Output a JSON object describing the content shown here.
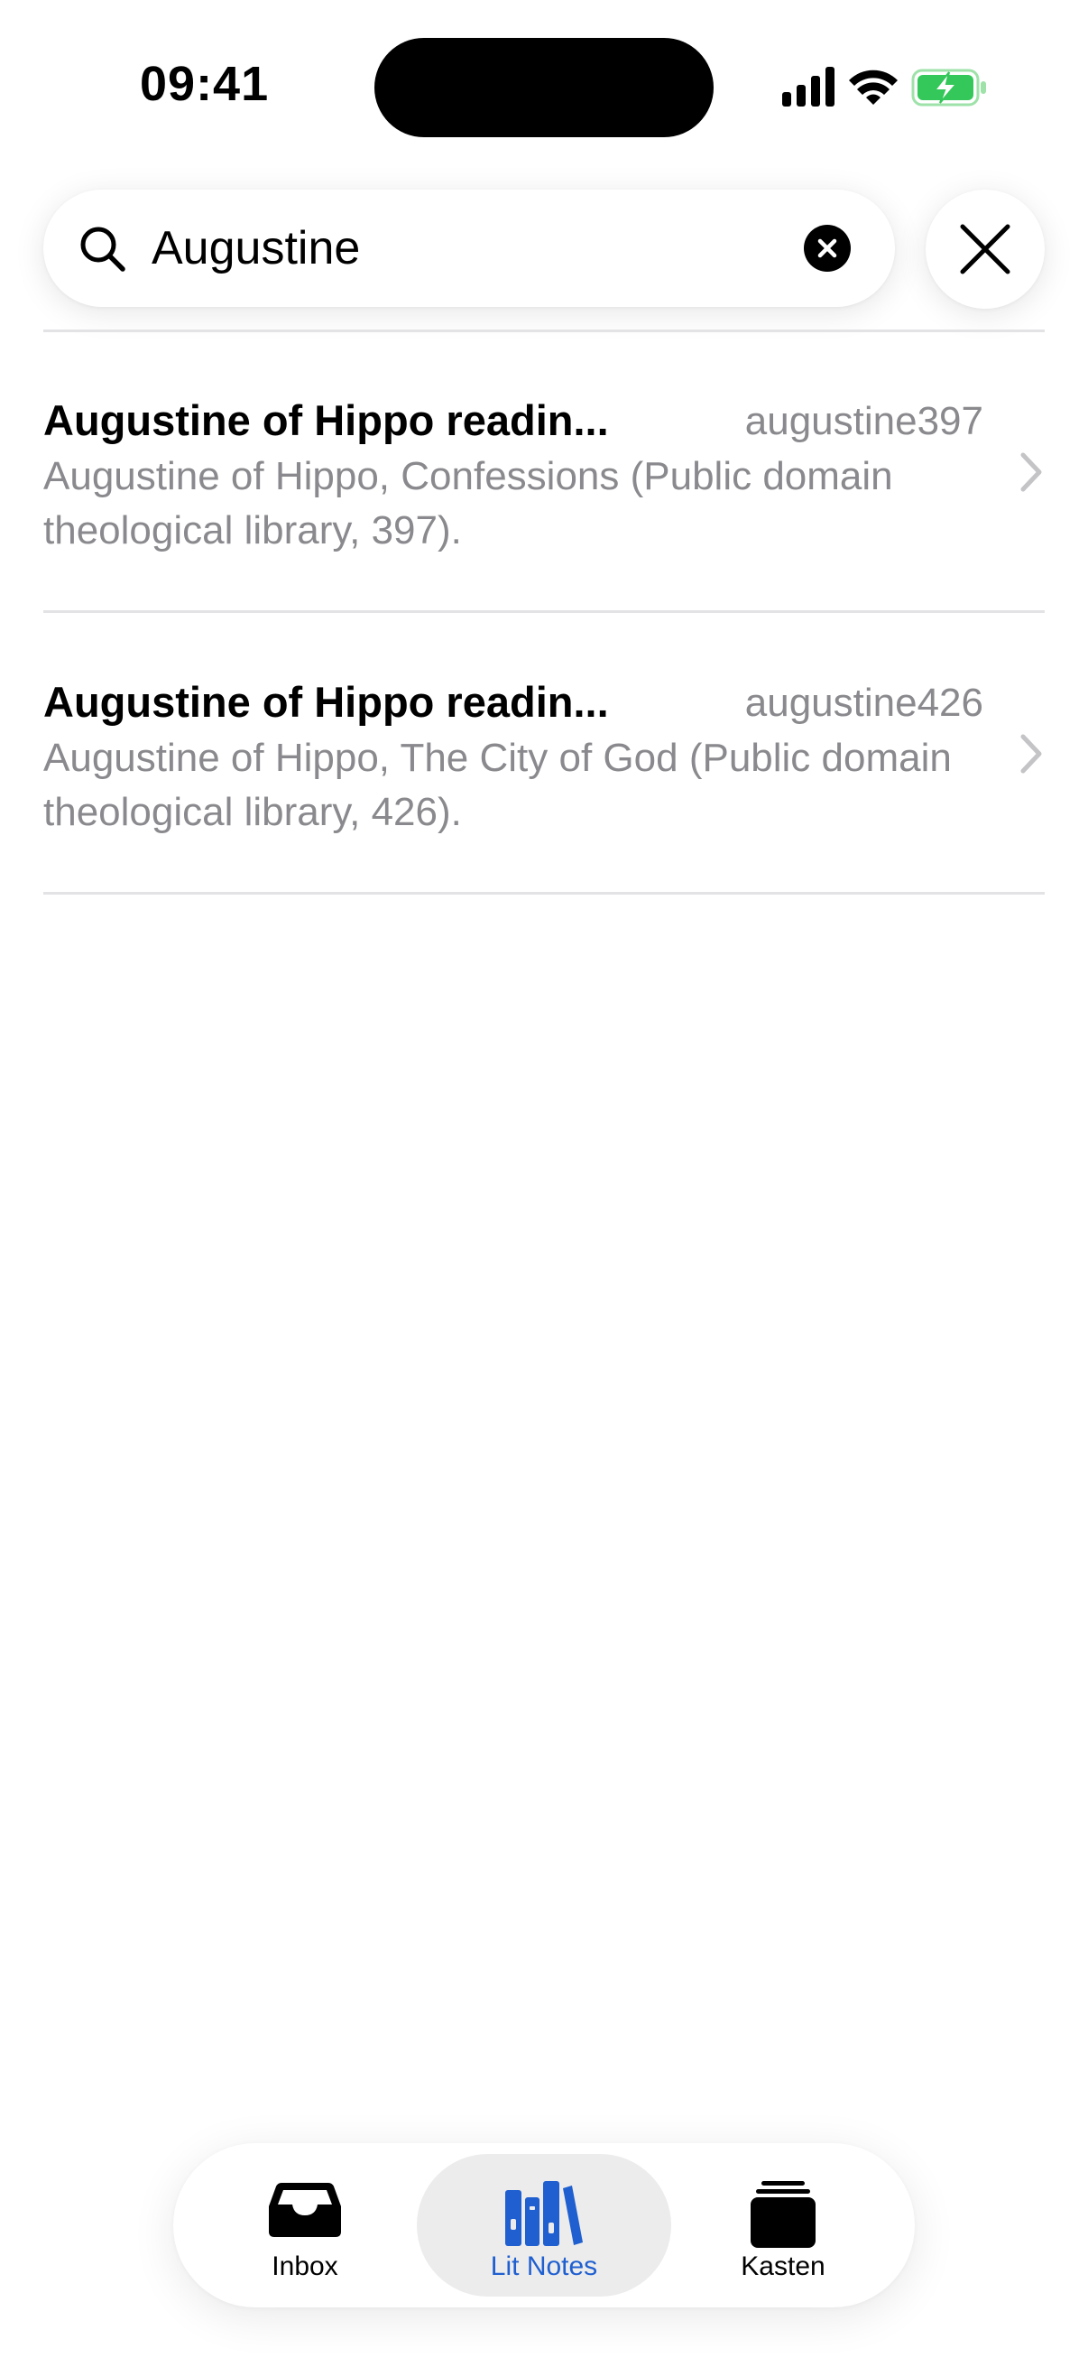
{
  "status_bar": {
    "time": "09:41"
  },
  "search": {
    "value": "Augustine",
    "placeholder": ""
  },
  "results": [
    {
      "title": "Augustine of Hippo readin...",
      "key": "augustine397",
      "description": "Augustine of Hippo, Confessions (Public domain theological library, 397)."
    },
    {
      "title": "Augustine of Hippo readin...",
      "key": "augustine426",
      "description": "Augustine of Hippo, The City of God (Public domain theological library, 426)."
    }
  ],
  "tab_bar": {
    "tabs": [
      {
        "label": "Inbox",
        "icon": "tray-icon",
        "active": false
      },
      {
        "label": "Lit Notes",
        "icon": "books-icon",
        "active": true
      },
      {
        "label": "Kasten",
        "icon": "stack-icon",
        "active": false
      }
    ]
  },
  "colors": {
    "accent": "#1f5fd0",
    "secondary_text": "#8a8a8e",
    "battery": "#34c759",
    "active_tab_bg": "#ececec"
  }
}
